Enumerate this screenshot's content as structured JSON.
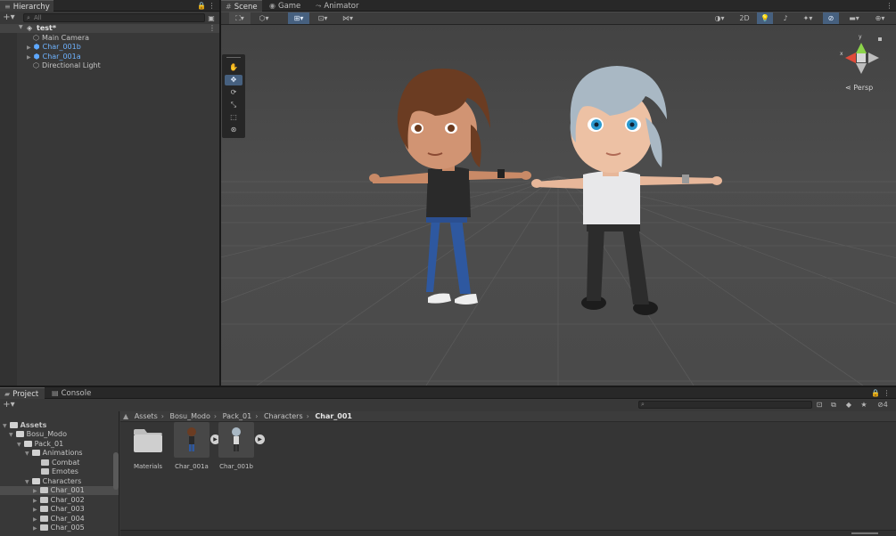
{
  "hierarchy": {
    "tab_label": "Hierarchy",
    "search_placeholder": "All",
    "scene_name": "test*",
    "items": [
      {
        "label": "Main Camera",
        "prefab": false,
        "expandable": false
      },
      {
        "label": "Char_001b",
        "prefab": true,
        "expandable": true
      },
      {
        "label": "Char_001a",
        "prefab": true,
        "expandable": true
      },
      {
        "label": "Directional Light",
        "prefab": false,
        "expandable": false
      }
    ]
  },
  "scene_tabs": {
    "scene": "Scene",
    "game": "Game",
    "animator": "Animator"
  },
  "scene_toolbar": {
    "mode_2d": "2D"
  },
  "gizmo": {
    "projection": "Persp",
    "x_axis": "x",
    "y_axis": "y"
  },
  "project_tabs": {
    "project": "Project",
    "console": "Console"
  },
  "project": {
    "visibility_count": "4",
    "breadcrumb": [
      "Assets",
      "Bosu_Modo",
      "Pack_01",
      "Characters"
    ],
    "breadcrumb_current": "Char_001",
    "tree": [
      {
        "label": "Assets",
        "indent": 0,
        "open": true
      },
      {
        "label": "Bosu_Modo",
        "indent": 1,
        "open": true
      },
      {
        "label": "Pack_01",
        "indent": 2,
        "open": true
      },
      {
        "label": "Animations",
        "indent": 3,
        "open": true
      },
      {
        "label": "Combat",
        "indent": 4,
        "open": false
      },
      {
        "label": "Emotes",
        "indent": 4,
        "open": false
      },
      {
        "label": "Characters",
        "indent": 3,
        "open": true
      },
      {
        "label": "Char_001",
        "indent": 4,
        "open": false,
        "selected": true
      },
      {
        "label": "Char_002",
        "indent": 4,
        "open": false
      },
      {
        "label": "Char_003",
        "indent": 4,
        "open": false
      },
      {
        "label": "Char_004",
        "indent": 4,
        "open": false
      },
      {
        "label": "Char_005",
        "indent": 4,
        "open": false
      }
    ],
    "assets": [
      {
        "label": "Materials",
        "kind": "folder"
      },
      {
        "label": "Char_001a",
        "kind": "prefab"
      },
      {
        "label": "Char_001b",
        "kind": "prefab"
      }
    ]
  },
  "colors": {
    "accent_blue": "#5ea8ff",
    "active_tool": "#46607f",
    "panel_bg": "#383838"
  }
}
